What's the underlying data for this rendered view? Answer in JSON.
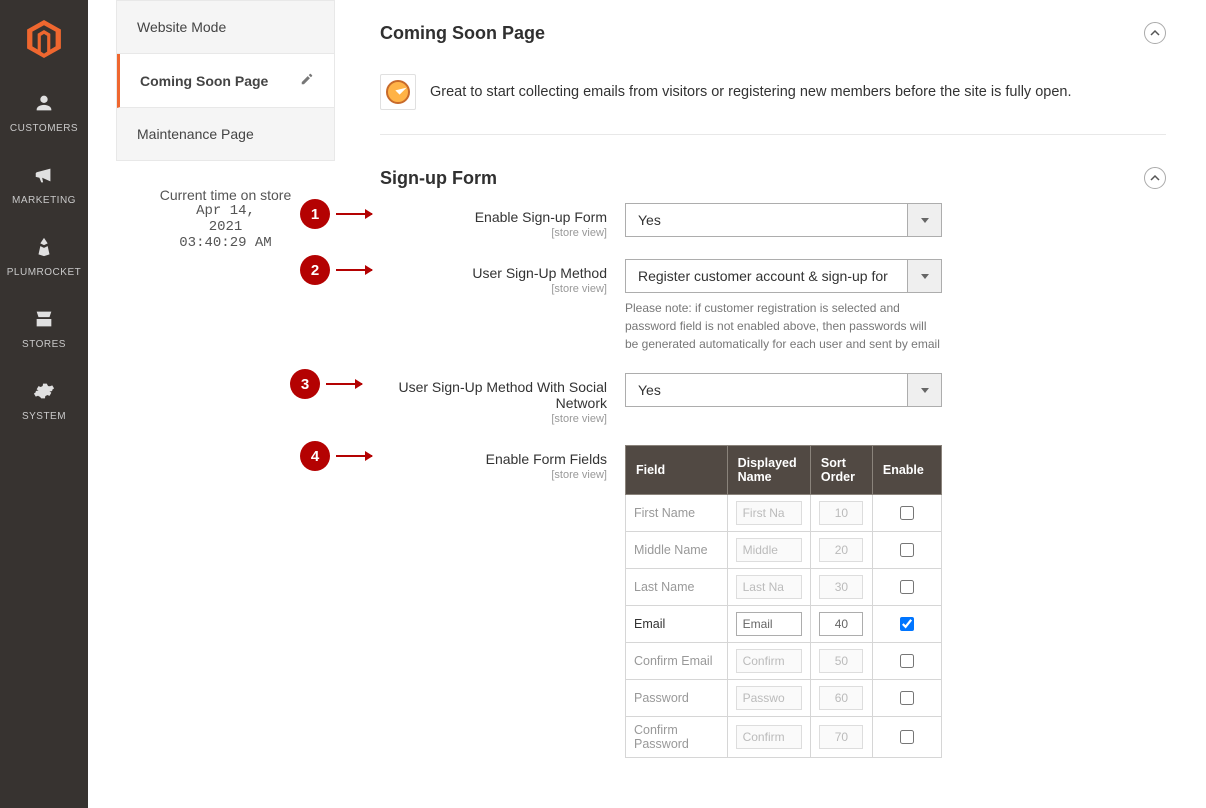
{
  "nav": {
    "items": [
      {
        "name": "customers",
        "label": "CUSTOMERS"
      },
      {
        "name": "marketing",
        "label": "MARKETING"
      },
      {
        "name": "plumrocket",
        "label": "PLUMROCKET"
      },
      {
        "name": "stores",
        "label": "STORES"
      },
      {
        "name": "system",
        "label": "SYSTEM"
      }
    ]
  },
  "side": {
    "tabs": [
      {
        "name": "website-mode",
        "label": "Website Mode",
        "active": false
      },
      {
        "name": "coming-soon",
        "label": "Coming Soon Page",
        "active": true
      },
      {
        "name": "maintenance",
        "label": "Maintenance Page",
        "active": false
      }
    ],
    "clock_label": "Current time on store",
    "clock_value": "Apr 14,\n2021\n03:40:29 AM"
  },
  "sections": {
    "coming_soon": {
      "title": "Coming Soon Page",
      "intro": "Great to start collecting emails from visitors or registering new members before the site is fully open."
    },
    "signup": {
      "title": "Sign-up Form",
      "scope_label": "[store view]",
      "fields": {
        "enable_form": {
          "label": "Enable Sign-up Form",
          "value": "Yes",
          "marker": "1"
        },
        "method": {
          "label": "User Sign-Up Method",
          "value": "Register customer account & sign-up for",
          "marker": "2",
          "note": "Please note: if customer registration is selected and password field is not enabled above, then passwords will be generated automatically for each user and sent by email"
        },
        "social": {
          "label": "User Sign-Up Method With Social Network",
          "value": "Yes",
          "marker": "3"
        },
        "form_fields_label": {
          "label": "Enable Form Fields",
          "marker": "4"
        }
      },
      "table": {
        "headers": {
          "field": "Field",
          "name": "Displayed Name",
          "sort": "Sort Order",
          "enable": "Enable"
        },
        "rows": [
          {
            "field": "First Name",
            "name": "First Na",
            "sort": "10",
            "enable": false,
            "required": false
          },
          {
            "field": "Middle Name",
            "name": "Middle",
            "sort": "20",
            "enable": false,
            "required": false
          },
          {
            "field": "Last Name",
            "name": "Last Na",
            "sort": "30",
            "enable": false,
            "required": false
          },
          {
            "field": "Email",
            "name": "Email",
            "sort": "40",
            "enable": true,
            "required": true
          },
          {
            "field": "Confirm Email",
            "name": "Confirm",
            "sort": "50",
            "enable": false,
            "required": false
          },
          {
            "field": "Password",
            "name": "Passwo",
            "sort": "60",
            "enable": false,
            "required": false
          },
          {
            "field": "Confirm Password",
            "name": "Confirm",
            "sort": "70",
            "enable": false,
            "required": false
          }
        ]
      }
    }
  }
}
